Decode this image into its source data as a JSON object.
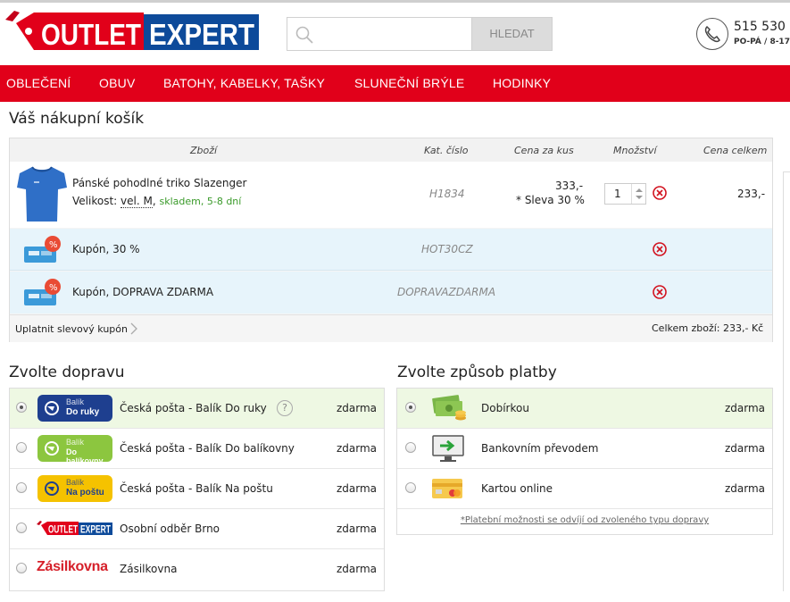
{
  "brand": {
    "word1": "OUTLET",
    "word2": "EXPERT",
    "red": "#e1001a",
    "blue": "#0d4a9a"
  },
  "search": {
    "placeholder": "",
    "button": "HLEDAT"
  },
  "contact": {
    "phone": "515 530",
    "hours": "PO-PÁ / 8-17"
  },
  "nav": [
    "OBLEČENÍ",
    "OBUV",
    "BATOHY, KABELKY, TAŠKY",
    "SLUNEČNÍ BRÝLE",
    "HODINKY"
  ],
  "page_title": "Váš nákupní košík",
  "cart": {
    "headers": {
      "item": "Zboží",
      "code": "Kat. číslo",
      "unit_price": "Cena za kus",
      "qty": "Množství",
      "total": "Cena celkem"
    },
    "product": {
      "name": "Pánské pohodlné triko Slazenger",
      "size_label": "Velikost:",
      "size_value": "vel. M",
      "size_sep": ",",
      "stock": "skladem, 5-8 dní",
      "code": "H1834",
      "price": "333,-",
      "discount": "* Sleva 30 %",
      "qty": "1",
      "total": "233,-"
    },
    "coupons": [
      {
        "name": "Kupón, 30 %",
        "code": "HOT30CZ"
      },
      {
        "name": "Kupón, DOPRAVA ZDARMA",
        "code": "DOPRAVAZDARMA"
      }
    ],
    "apply_coupon": "Uplatnit slevový kupón",
    "summary": "Celkem zboží: 233,- Kč"
  },
  "shipping": {
    "title": "Zvolte dopravu",
    "options": [
      {
        "label": "Česká pošta - Balík Do ruky",
        "price": "zdarma",
        "selected": true,
        "logo_l1": "Balík",
        "logo_l2": "Do ruky",
        "logo_color": "#1e3f8f",
        "help": "?"
      },
      {
        "label": "Česká pošta - Balík Do balíkovny",
        "price": "zdarma",
        "selected": false,
        "logo_l1": "Balík",
        "logo_l2": "Do balíkovny",
        "logo_color": "#8cc63f"
      },
      {
        "label": "Česká pošta - Balík Na poštu",
        "price": "zdarma",
        "selected": false,
        "logo_l1": "Balík",
        "logo_l2": "Na poštu",
        "logo_color": "#f5c200"
      },
      {
        "label": "Osobní odběr Brno",
        "price": "zdarma",
        "selected": false,
        "logo_l1": "OUTLET",
        "logo_l2": "EXPERT"
      },
      {
        "label": "Zásilkovna",
        "price": "zdarma",
        "selected": false,
        "logo_l1": "Zásilkovna"
      }
    ]
  },
  "payment": {
    "title": "Zvolte způsob platby",
    "options": [
      {
        "label": "Dobírkou",
        "price": "zdarma",
        "selected": true
      },
      {
        "label": "Bankovním převodem",
        "price": "zdarma",
        "selected": false
      },
      {
        "label": "Kartou online",
        "price": "zdarma",
        "selected": false
      }
    ],
    "note": "*Platební možnosti se odvíjí od zvoleného typu dopravy"
  }
}
